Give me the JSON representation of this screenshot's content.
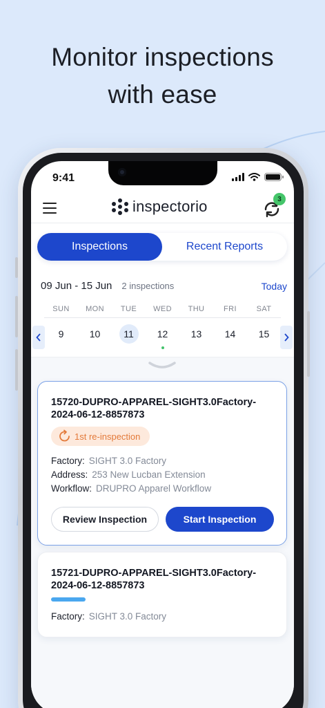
{
  "headline": {
    "line1": "Monitor inspections",
    "line2": "with ease"
  },
  "status_bar": {
    "time": "9:41"
  },
  "header": {
    "logo_text": "inspectorio",
    "sync_count": "3"
  },
  "tabs": [
    {
      "label": "Inspections",
      "active": true
    },
    {
      "label": "Recent Reports",
      "active": false
    }
  ],
  "calendar": {
    "range": "09 Jun - 15 Jun",
    "count": "2  inspections",
    "today_label": "Today",
    "weekdays": [
      "SUN",
      "MON",
      "TUE",
      "WED",
      "THU",
      "FRI",
      "SAT"
    ],
    "days": [
      "9",
      "10",
      "11",
      "12",
      "13",
      "14",
      "15"
    ],
    "prev_icon": "chevron-left-icon",
    "next_icon": "chevron-right-icon"
  },
  "cards": [
    {
      "title": "15720-DUPRO-APPAREL-SIGHT3.0Factory-2024-06-12-8857873",
      "badge": "1st re-inspection",
      "factory_label": "Factory:",
      "factory_value": "SIGHT 3.0 Factory",
      "address_label": "Address:",
      "address_value": "253 New Lucban Extension",
      "workflow_label": "Workflow:",
      "workflow_value": "DRUPRO Apparel Workflow",
      "review_label": "Review Inspection",
      "start_label": "Start Inspection"
    },
    {
      "title": "15721-DUPRO-APPAREL-SIGHT3.0Factory-2024-06-12-8857873",
      "factory_label": "Factory:",
      "factory_value": "SIGHT 3.0 Factory"
    }
  ],
  "colors": {
    "primary": "#1d47cc",
    "badge_bg": "#fde9dc",
    "badge_text": "#e37a3a",
    "dot": "#43c26b"
  }
}
